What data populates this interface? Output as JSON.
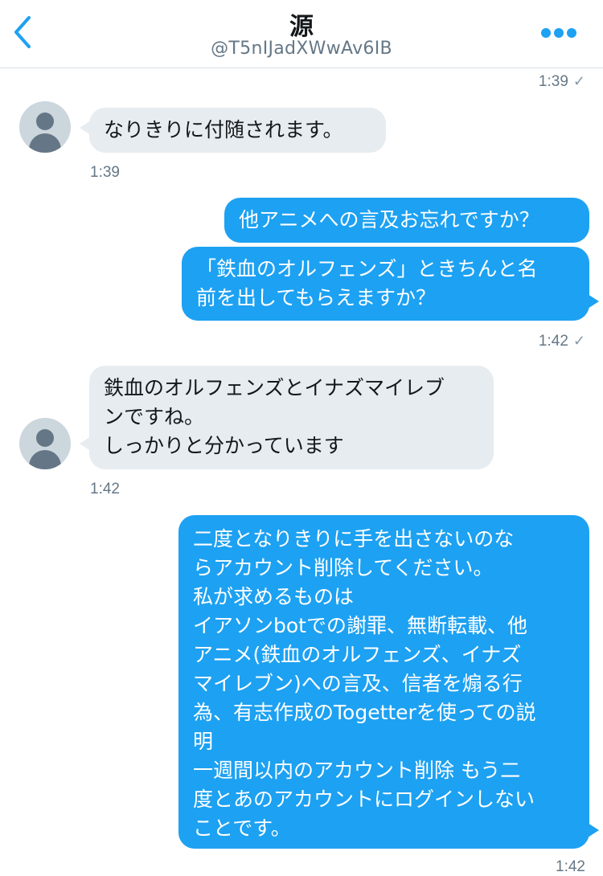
{
  "header": {
    "title": "源",
    "handle": "@T5nIJadXWwAv6IB"
  },
  "timestamps": {
    "t1": "1:39",
    "t2": "1:39",
    "t3": "1:42",
    "t4": "1:42",
    "t5": "1:42"
  },
  "messages": [
    {
      "from": "them",
      "text": "なりきりに付随されます。"
    },
    {
      "from": "me",
      "text": "他アニメへの言及お忘れですか？"
    },
    {
      "from": "me",
      "text": "「鉄血のオルフェンズ」ときちんと名\n前を出してもらえますか？"
    },
    {
      "from": "them",
      "text": "鉄血のオルフェンズとイナズマイレブ\nンですね。\nしっかりと分かっています"
    },
    {
      "from": "me",
      "text": "二度となりきりに手を出さないのな\nらアカウント削除してください。\n私が求めるものは\nイアソンbotでの謝罪、無断転載、他\nアニメ(鉄血のオルフェンズ、イナズ\nマイレブン)への言及、信者を煽る行\n為、有志作成のTogetterを使っての説\n明\n一週間以内のアカウント削除 もう二\n度とあのアカウントにログインしない\nことです。"
    }
  ],
  "colors": {
    "outgoing": "#1da1f2",
    "incoming": "#e6ecf0",
    "accent": "#1da1f2"
  },
  "icons": {
    "back": "chevron-left-icon",
    "more": "more-dots-icon",
    "read": "check-icon",
    "avatar": "default-avatar-icon"
  }
}
